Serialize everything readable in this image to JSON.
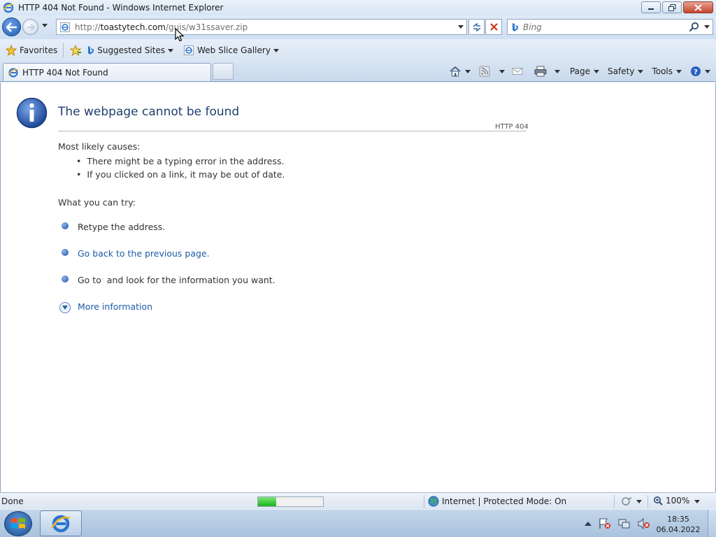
{
  "window": {
    "title": "HTTP 404 Not Found - Windows Internet Explorer"
  },
  "nav": {
    "url_prefix": "http://",
    "url_domain": "toastytech.com",
    "url_path": "/guis/w31ssaver.zip",
    "search_placeholder": "Bing"
  },
  "favorites_bar": {
    "favorites_label": "Favorites",
    "suggested_sites_label": "Suggested Sites",
    "web_slice_label": "Web Slice Gallery"
  },
  "tabs": [
    {
      "label": "HTTP 404 Not Found"
    }
  ],
  "command_bar": {
    "page_label": "Page",
    "safety_label": "Safety",
    "tools_label": "Tools"
  },
  "content": {
    "title": "The webpage cannot be found",
    "http_code": "HTTP 404",
    "causes_heading": "Most likely causes:",
    "causes": [
      "There might be a typing error in the address.",
      "If you clicked on a link, it may be out of date."
    ],
    "try_heading": "What you can try:",
    "try_items": [
      {
        "text": "Retype the address."
      },
      {
        "text": "Go back to the previous page."
      },
      {
        "text": "Go to  and look for the information you want."
      }
    ],
    "more_info": "More information"
  },
  "status_bar": {
    "status": "Done",
    "progress": 0.28,
    "zone": "Internet | Protected Mode: On",
    "zoom": "100%"
  },
  "taskbar": {
    "time": "18:35",
    "date": "06.04.2022"
  },
  "colors": {
    "link": "#1e5ca8",
    "title": "#1f3f6e",
    "progress": "#19b21a"
  }
}
